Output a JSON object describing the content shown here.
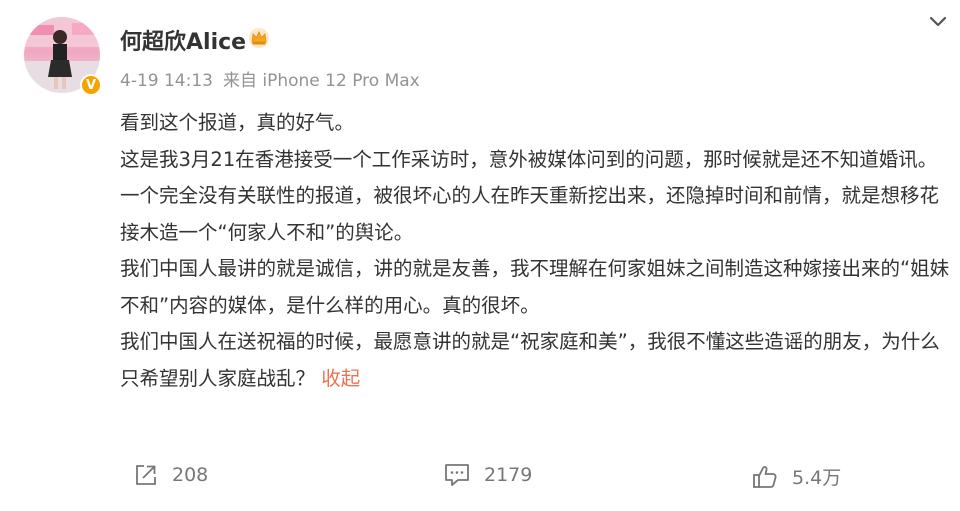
{
  "post": {
    "username": "何超欣Alice",
    "time": "4-19 14:13",
    "source": "来自 iPhone 12 Pro Max",
    "paragraphs": [
      "看到这个报道，真的好气。",
      "这是我3月21在香港接受一个工作采访时，意外被媒体问到的问题，那时候就是还不知道婚讯。",
      "一个完全没有关联性的报道，被很坏心的人在昨天重新挖出来，还隐掉时间和前情，就是想移花接木造一个“何家人不和”的舆论。",
      "我们中国人最讲的就是诚信，讲的就是友善，我不理解在何家姐妹之间制造这种嫁接出来的“姐妹不和”内容的媒体，是什么样的用心。真的很坏。",
      "我们中国人在送祝福的时候，最愿意讲的就是“祝家庭和美”，我很不懂这些造谣的朋友，为什么只希望别人家庭战乱？"
    ],
    "collapse_label": "收起",
    "verified_badge": "V"
  },
  "footer": {
    "repost_count": "208",
    "comment_count": "2179",
    "like_count": "5.4万"
  },
  "icons": {
    "crown": "crown-member-icon",
    "chevron": "chevron-down-icon",
    "repost": "repost-icon",
    "comment": "comment-icon",
    "like": "thumbs-up-icon"
  },
  "colors": {
    "accent": "#eb7350",
    "verified": "#f6a300",
    "muted": "#939393"
  }
}
